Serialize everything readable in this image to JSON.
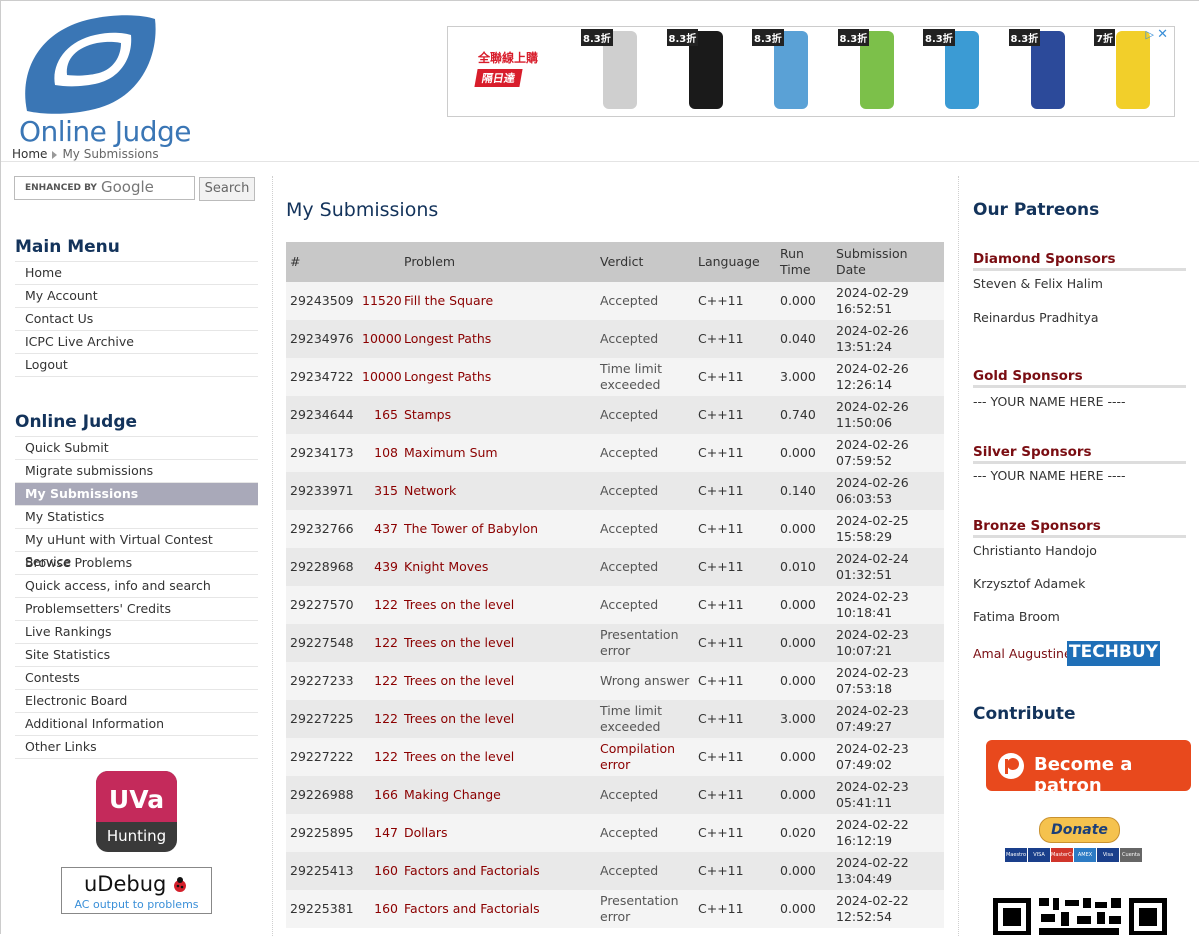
{
  "site": {
    "logo_text": "Online Judge"
  },
  "breadcrumb": {
    "home": "Home",
    "current": "My Submissions"
  },
  "ad": {
    "promo_line1": "全聯線上購",
    "promo_line2": "隔日達",
    "badges": [
      "8.3折",
      "8.3折",
      "8.3折",
      "8.3折",
      "8.3折",
      "8.3折",
      "7折"
    ]
  },
  "search": {
    "enhanced_by": "ENHANCED BY",
    "google": "Google",
    "button": "Search"
  },
  "main_menu": {
    "title": "Main Menu",
    "items": [
      "Home",
      "My Account",
      "Contact Us",
      "ICPC Live Archive",
      "Logout"
    ]
  },
  "oj_menu": {
    "title": "Online Judge",
    "items": [
      "Quick Submit",
      "Migrate submissions",
      "My Submissions",
      "My Statistics",
      "My uHunt with Virtual Contest Service",
      "Browse Problems",
      "Quick access, info and search",
      "Problemsetters' Credits",
      "Live Rankings",
      "Site Statistics",
      "Contests",
      "Electronic Board",
      "Additional Information",
      "Other Links"
    ]
  },
  "uva_badge": {
    "top": "UVa",
    "bottom": "Hunting"
  },
  "udebug": {
    "title": "uDebug",
    "subtitle": "AC output to problems"
  },
  "main": {
    "title": "My Submissions",
    "headers": [
      "#",
      "Problem",
      "Verdict",
      "Language",
      "Run Time",
      "Submission Date"
    ],
    "rows": [
      {
        "id": "29243509",
        "num": "11520",
        "title": "Fill the Square",
        "verdict": "Accepted",
        "lang": "C++11",
        "time": "0.000",
        "date": "2024-02-29",
        "clock": "16:52:51"
      },
      {
        "id": "29234976",
        "num": "10000",
        "title": "Longest Paths",
        "verdict": "Accepted",
        "lang": "C++11",
        "time": "0.040",
        "date": "2024-02-26",
        "clock": "13:51:24"
      },
      {
        "id": "29234722",
        "num": "10000",
        "title": "Longest Paths",
        "verdict": "Time limit exceeded",
        "lang": "C++11",
        "time": "3.000",
        "date": "2024-02-26",
        "clock": "12:26:14"
      },
      {
        "id": "29234644",
        "num": "165",
        "title": "Stamps",
        "verdict": "Accepted",
        "lang": "C++11",
        "time": "0.740",
        "date": "2024-02-26",
        "clock": "11:50:06"
      },
      {
        "id": "29234173",
        "num": "108",
        "title": "Maximum Sum",
        "verdict": "Accepted",
        "lang": "C++11",
        "time": "0.000",
        "date": "2024-02-26",
        "clock": "07:59:52"
      },
      {
        "id": "29233971",
        "num": "315",
        "title": "Network",
        "verdict": "Accepted",
        "lang": "C++11",
        "time": "0.140",
        "date": "2024-02-26",
        "clock": "06:03:53"
      },
      {
        "id": "29232766",
        "num": "437",
        "title": "The Tower of Babylon",
        "verdict": "Accepted",
        "lang": "C++11",
        "time": "0.000",
        "date": "2024-02-25",
        "clock": "15:58:29"
      },
      {
        "id": "29228968",
        "num": "439",
        "title": "Knight Moves",
        "verdict": "Accepted",
        "lang": "C++11",
        "time": "0.010",
        "date": "2024-02-24",
        "clock": "01:32:51"
      },
      {
        "id": "29227570",
        "num": "122",
        "title": "Trees on the level",
        "verdict": "Accepted",
        "lang": "C++11",
        "time": "0.000",
        "date": "2024-02-23",
        "clock": "10:18:41"
      },
      {
        "id": "29227548",
        "num": "122",
        "title": "Trees on the level",
        "verdict": "Presentation error",
        "lang": "C++11",
        "time": "0.000",
        "date": "2024-02-23",
        "clock": "10:07:21"
      },
      {
        "id": "29227233",
        "num": "122",
        "title": "Trees on the level",
        "verdict": "Wrong answer",
        "lang": "C++11",
        "time": "0.000",
        "date": "2024-02-23",
        "clock": "07:53:18"
      },
      {
        "id": "29227225",
        "num": "122",
        "title": "Trees on the level",
        "verdict": "Time limit exceeded",
        "lang": "C++11",
        "time": "3.000",
        "date": "2024-02-23",
        "clock": "07:49:27"
      },
      {
        "id": "29227222",
        "num": "122",
        "title": "Trees on the level",
        "verdict": "Compilation error",
        "lang": "C++11",
        "time": "0.000",
        "date": "2024-02-23",
        "clock": "07:49:02"
      },
      {
        "id": "29226988",
        "num": "166",
        "title": "Making Change",
        "verdict": "Accepted",
        "lang": "C++11",
        "time": "0.000",
        "date": "2024-02-23",
        "clock": "05:41:11"
      },
      {
        "id": "29225895",
        "num": "147",
        "title": "Dollars",
        "verdict": "Accepted",
        "lang": "C++11",
        "time": "0.020",
        "date": "2024-02-22",
        "clock": "16:12:19"
      },
      {
        "id": "29225413",
        "num": "160",
        "title": "Factors and Factorials",
        "verdict": "Accepted",
        "lang": "C++11",
        "time": "0.000",
        "date": "2024-02-22",
        "clock": "13:04:49"
      },
      {
        "id": "29225381",
        "num": "160",
        "title": "Factors and Factorials",
        "verdict": "Presentation error",
        "lang": "C++11",
        "time": "0.000",
        "date": "2024-02-22",
        "clock": "12:52:54"
      }
    ]
  },
  "patreons": {
    "title": "Our Patreons",
    "diamond": {
      "title": "Diamond Sponsors",
      "names": [
        "Steven & Felix Halim",
        "Reinardus Pradhitya"
      ]
    },
    "gold": {
      "title": "Gold Sponsors",
      "names": [
        "--- YOUR NAME HERE ----"
      ]
    },
    "silver": {
      "title": "Silver Sponsors",
      "names": [
        "--- YOUR NAME HERE ----"
      ]
    },
    "bronze": {
      "title": "Bronze Sponsors",
      "names": [
        "Christianto Handojo",
        "Krzysztof Adamek",
        "Fatima Broom",
        "Amal Augustine"
      ]
    },
    "techbuy": "TECHBUY"
  },
  "contribute": {
    "title": "Contribute",
    "patron_button": "Become a patron",
    "donate_button": "Donate",
    "cards": [
      "Maestro",
      "VISA",
      "MasterCard",
      "AMEX",
      "Visa",
      "Cuenta bancaria"
    ]
  }
}
